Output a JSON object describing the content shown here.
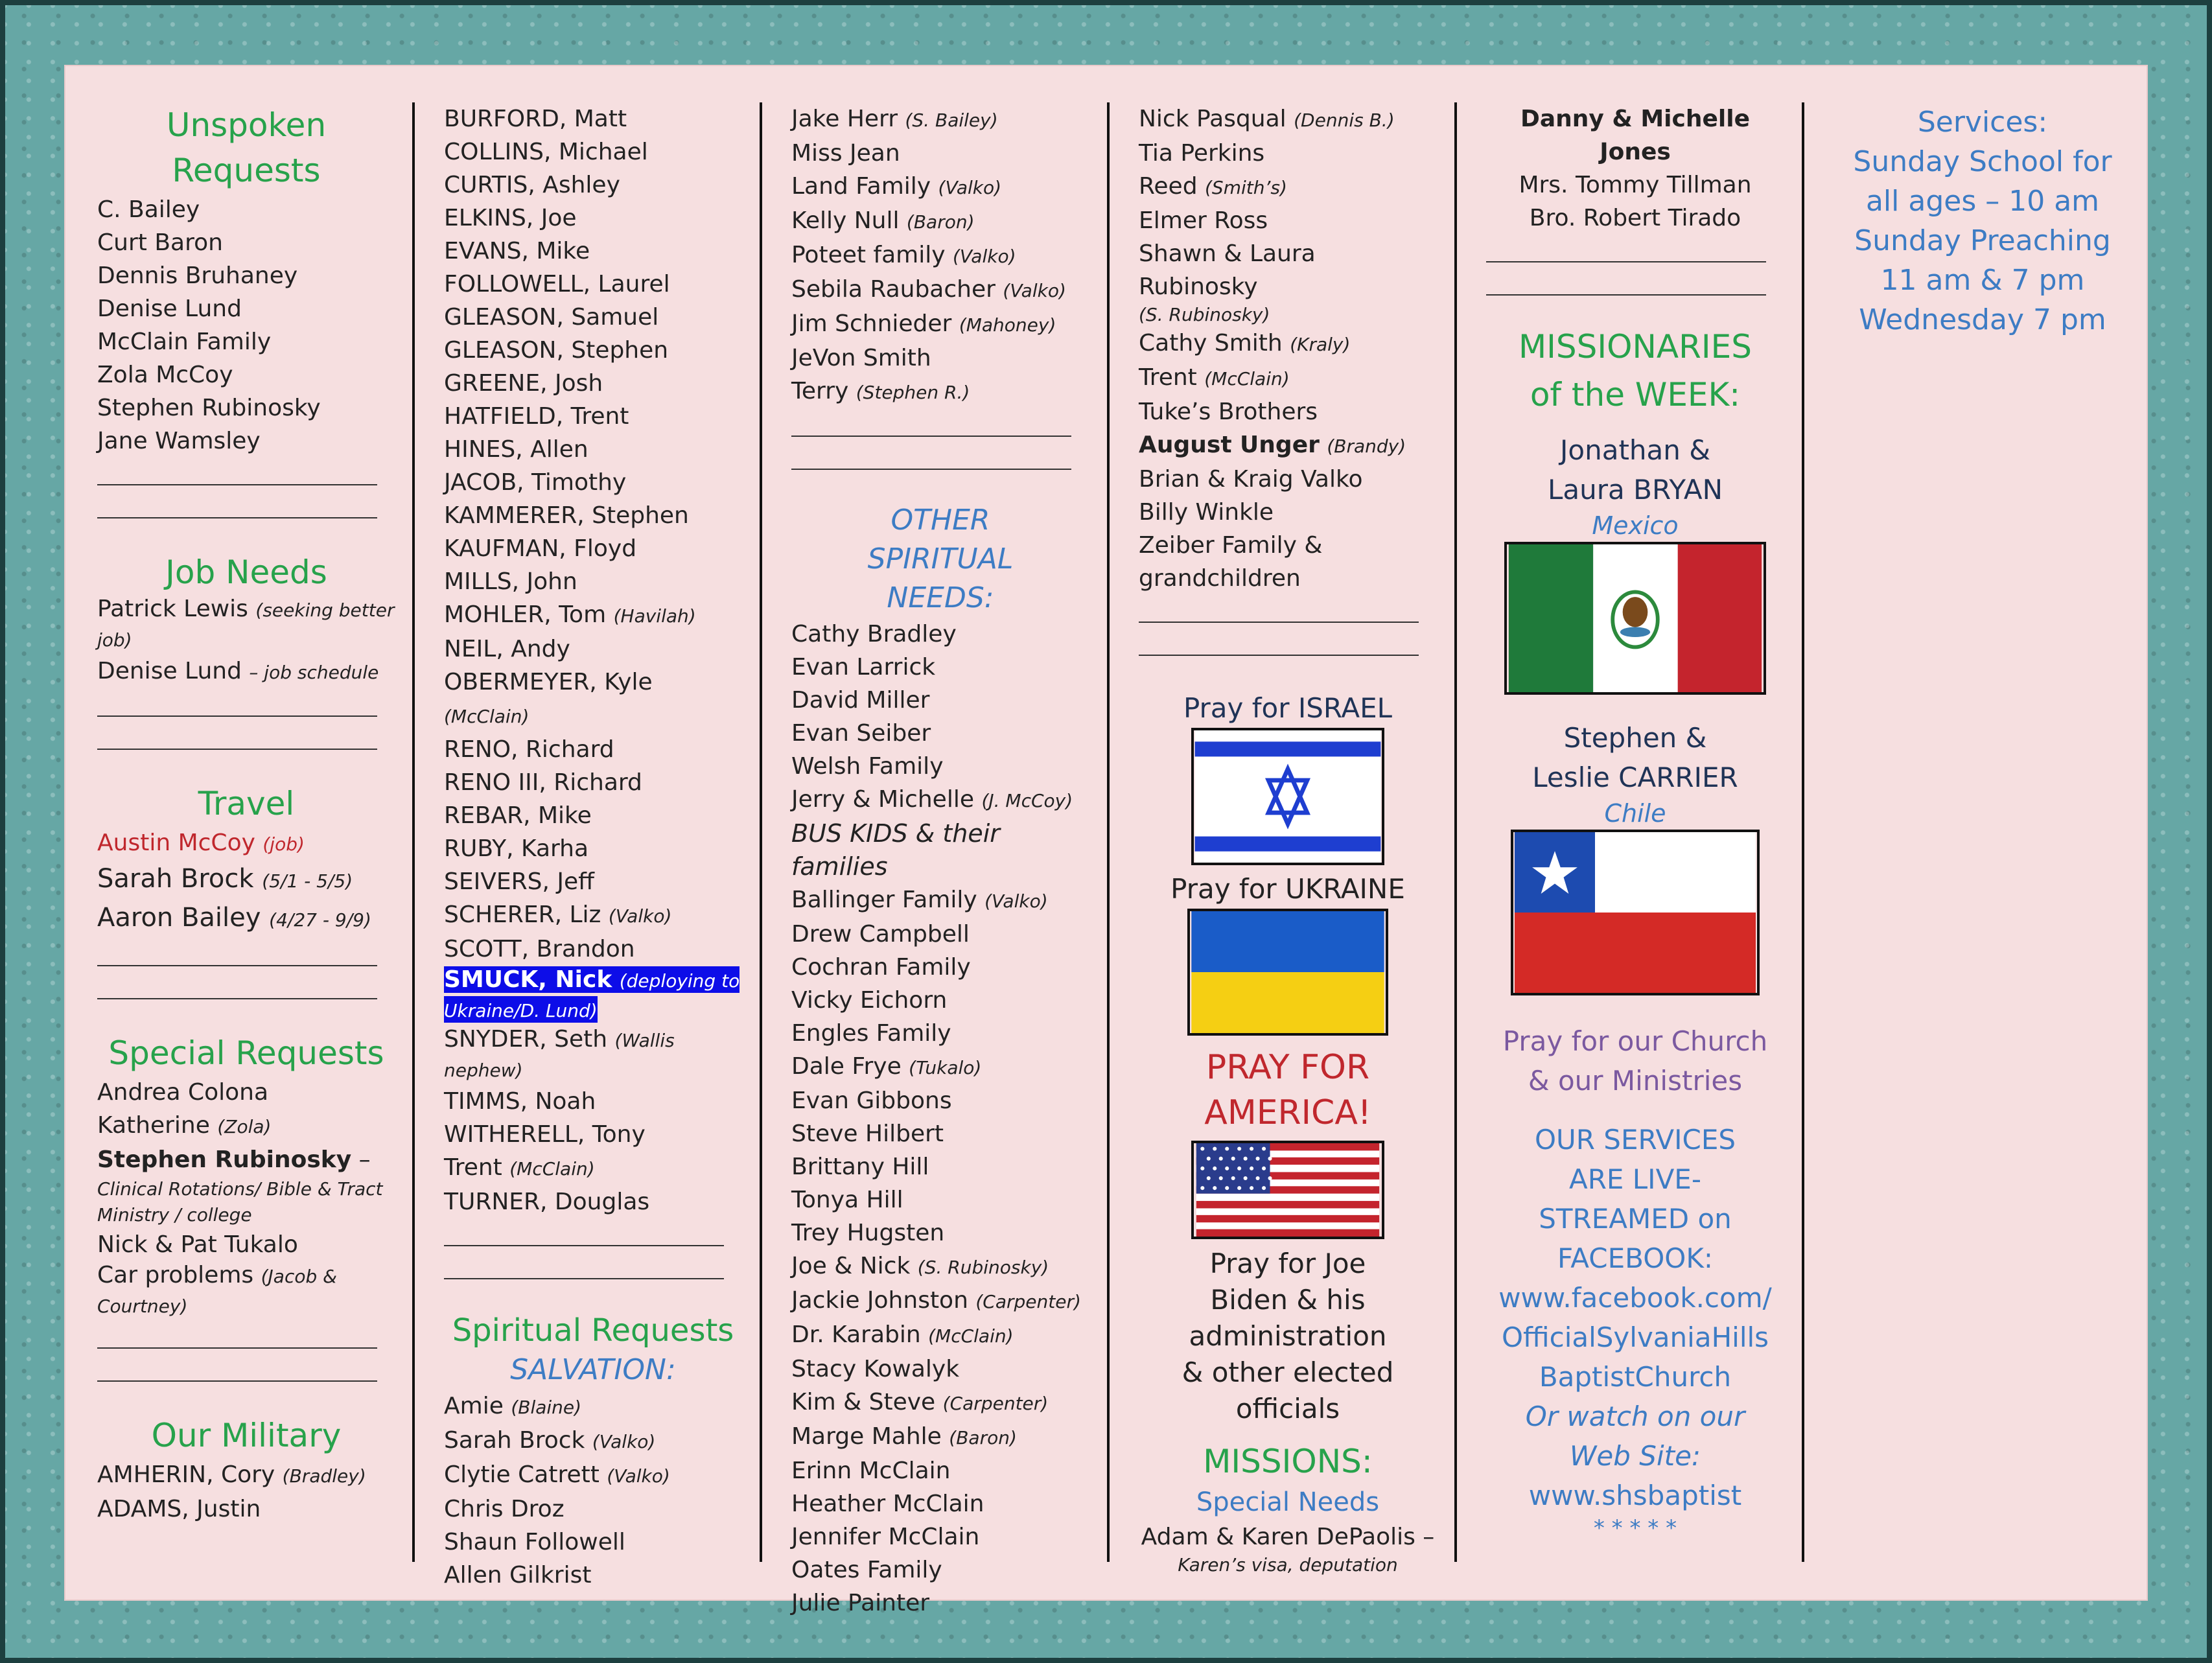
{
  "col1": {
    "unspoken_title": "Unspoken Requests",
    "unspoken": [
      "C. Bailey",
      "Curt Baron",
      "Dennis Bruhaney",
      "Denise Lund",
      "McClain Family",
      "Zola McCoy",
      "Stephen Rubinosky",
      "Jane Wamsley"
    ],
    "job_title": "Job Needs",
    "job1_name": "Patrick Lewis",
    "job1_note": "(seeking better job)",
    "job2_name": "Denise Lund",
    "job2_note": "– job schedule",
    "travel_title": "Travel",
    "travel1_name": "Austin McCoy",
    "travel1_note": "(job)",
    "travel2_name": "Sarah Brock",
    "travel2_note": "(5/1 - 5/5)",
    "travel3_name": "Aaron Bailey",
    "travel3_note": "(4/27 - 9/9)",
    "special_title": "Special Requests",
    "special1": "Andrea Colona",
    "special2_name": "Katherine",
    "special2_note": "(Zola)",
    "special3_name": "Stephen Rubinosky",
    "special3_dash": " –",
    "special3_note": "Clinical Rotations/ Bible & Tract Ministry / college",
    "special4": "Nick & Pat Tukalo",
    "special5_name": "Car problems",
    "special5_note": "(Jacob & Courtney)",
    "military_title": "Our Military",
    "mil1_name": "AMHERIN, Cory",
    "mil1_note": "(Bradley)",
    "mil2": "ADAMS, Justin"
  },
  "col2": {
    "names": [
      {
        "name": "BURFORD, Matt",
        "note": ""
      },
      {
        "name": "COLLINS, Michael",
        "note": ""
      },
      {
        "name": "CURTIS, Ashley",
        "note": ""
      },
      {
        "name": "ELKINS, Joe",
        "note": ""
      },
      {
        "name": "EVANS, Mike",
        "note": ""
      },
      {
        "name": "FOLLOWELL, Laurel",
        "note": ""
      },
      {
        "name": "GLEASON, Samuel",
        "note": ""
      },
      {
        "name": "GLEASON, Stephen",
        "note": ""
      },
      {
        "name": "GREENE, Josh",
        "note": ""
      },
      {
        "name": "HATFIELD, Trent",
        "note": ""
      },
      {
        "name": "HINES, Allen",
        "note": ""
      },
      {
        "name": "JACOB, Timothy",
        "note": ""
      },
      {
        "name": "KAMMERER, Stephen",
        "note": ""
      },
      {
        "name": "KAUFMAN, Floyd",
        "note": ""
      },
      {
        "name": "MILLS, John",
        "note": ""
      },
      {
        "name": "MOHLER, Tom",
        "note": "(Havilah)"
      },
      {
        "name": "NEIL, Andy",
        "note": ""
      },
      {
        "name": "OBERMEYER, Kyle",
        "note": "(McClain)"
      },
      {
        "name": "RENO, Richard",
        "note": ""
      },
      {
        "name": "RENO III, Richard",
        "note": ""
      },
      {
        "name": "REBAR, Mike",
        "note": ""
      },
      {
        "name": "RUBY, Karha",
        "note": ""
      },
      {
        "name": "SEIVERS, Jeff",
        "note": ""
      },
      {
        "name": "SCHERER, Liz",
        "note": "(Valko)"
      },
      {
        "name": "SCOTT, Brandon",
        "note": ""
      }
    ],
    "smuck_name": "SMUCK, Nick",
    "smuck_note": "(deploying to Ukraine/D. Lund)",
    "snyder_name": "SNYDER, Seth",
    "snyder_note": "(Wallis nephew)",
    "names2": [
      {
        "name": "TIMMS, Noah",
        "note": ""
      },
      {
        "name": "WITHERELL, Tony",
        "note": ""
      },
      {
        "name": "Trent",
        "note": "(McClain)"
      },
      {
        "name": "TURNER, Douglas",
        "note": ""
      }
    ],
    "spiritual_title": "Spiritual Requests",
    "salvation_title": "SALVATION:",
    "salvation": [
      {
        "name": "Amie",
        "note": "(Blaine)"
      },
      {
        "name": "Sarah Brock",
        "note": "(Valko)"
      },
      {
        "name": "Clytie Catrett",
        "note": "(Valko)"
      },
      {
        "name": "Chris Droz",
        "note": ""
      },
      {
        "name": "Shaun Followell",
        "note": ""
      },
      {
        "name": "Allen Gilkrist",
        "note": ""
      }
    ]
  },
  "col3": {
    "names": [
      {
        "name": "Jake Herr",
        "note": "(S. Bailey)"
      },
      {
        "name": "Miss Jean",
        "note": ""
      },
      {
        "name": "Land Family",
        "note": "(Valko)"
      },
      {
        "name": "Kelly Null",
        "note": "(Baron)"
      },
      {
        "name": "Poteet family",
        "note": "(Valko)"
      },
      {
        "name": "Sebila Raubacher",
        "note": "(Valko)"
      },
      {
        "name": "Jim Schnieder",
        "note": "(Mahoney)"
      },
      {
        "name": "JeVon Smith",
        "note": ""
      },
      {
        "name": "Terry",
        "note": "(Stephen R.)"
      }
    ],
    "other_title": "OTHER SPIRITUAL NEEDS:",
    "other": [
      {
        "name": "Cathy Bradley",
        "note": ""
      },
      {
        "name": "Evan Larrick",
        "note": ""
      },
      {
        "name": "David Miller",
        "note": ""
      },
      {
        "name": "Evan Seiber",
        "note": ""
      },
      {
        "name": "Welsh Family",
        "note": ""
      },
      {
        "name": "Jerry & Michelle",
        "note": "(J. McCoy)"
      }
    ],
    "bus_kids": "BUS KIDS & their families",
    "other2": [
      {
        "name": "Ballinger Family",
        "note": "(Valko)"
      },
      {
        "name": "Drew Campbell",
        "note": ""
      },
      {
        "name": "Cochran Family",
        "note": ""
      },
      {
        "name": "Vicky Eichorn",
        "note": ""
      },
      {
        "name": "Engles Family",
        "note": ""
      },
      {
        "name": "Dale Frye",
        "note": "(Tukalo)"
      },
      {
        "name": "Evan Gibbons",
        "note": ""
      },
      {
        "name": "Steve Hilbert",
        "note": ""
      },
      {
        "name": "Brittany Hill",
        "note": ""
      },
      {
        "name": "Tonya Hill",
        "note": ""
      },
      {
        "name": "Trey Hugsten",
        "note": ""
      },
      {
        "name": "Joe & Nick",
        "note": "(S. Rubinosky)"
      },
      {
        "name": "Jackie Johnston",
        "note": "(Carpenter)"
      },
      {
        "name": "Dr. Karabin",
        "note": "(McClain)"
      },
      {
        "name": "Stacy Kowalyk",
        "note": ""
      },
      {
        "name": "Kim & Steve",
        "note": "(Carpenter)"
      },
      {
        "name": "Marge Mahle",
        "note": "(Baron)"
      },
      {
        "name": "Erinn McClain",
        "note": ""
      },
      {
        "name": "Heather McClain",
        "note": ""
      },
      {
        "name": "Jennifer McClain",
        "note": ""
      },
      {
        "name": "Oates Family",
        "note": ""
      },
      {
        "name": "Julie Painter",
        "note": ""
      }
    ]
  },
  "col4": {
    "nick_name": "Nick Pasqual",
    "nick_note": "(Dennis B.)",
    "tia": "Tia Perkins",
    "reed_name": "Reed",
    "reed_note": "(Smith’s)",
    "elmer": "Elmer Ross",
    "shawn_name": "Shawn & Laura Rubinosky",
    "shawn_note": "(S. Rubinosky)",
    "cathy_name": "Cathy Smith",
    "cathy_note": "(Kraly)",
    "trent_name": "Trent",
    "trent_note": "(McClain)",
    "tuke": "Tuke’s Brothers",
    "august_name": "August Unger",
    "august_note": "(Brandy)",
    "brian": "Brian & Kraig Valko",
    "billy": "Billy Winkle",
    "zeiber": "Zeiber Family & grandchildren",
    "israel": "Pray for ISRAEL",
    "ukraine": "Pray for UKRAINE",
    "america": "PRAY FOR AMERICA!",
    "biden": "Pray for Joe Biden & his administration & other elected officials",
    "missions": "MISSIONS:",
    "special_needs": "Special Needs",
    "adam": "Adam & Karen DePaolis –",
    "adam_note": "Karen’s visa, deputation"
  },
  "col5": {
    "danny": "Danny & Michelle Jones",
    "tillman": "Mrs. Tommy Tillman",
    "tirado": "Bro. Robert Tirado",
    "missionaries_title": "MISSIONARIES of the WEEK:",
    "bryan": "Jonathan & Laura BRYAN",
    "mexico": "Mexico",
    "carrier": "Stephen & Leslie CARRIER",
    "chile": "Chile",
    "pray_church": "Pray for our Church & our Ministries",
    "livestream": "OUR SERVICES ARE LIVE-STREAMED on FACEBOOK:",
    "facebook": "www.facebook.com/ OfficialSylvaniaHills BaptistChurch",
    "watch": "Or watch on our Web Site:",
    "website": "www.shsbaptist",
    "stars": "* * * * *"
  },
  "col6": {
    "services": "Services:",
    "sunday_school": "Sunday School for all ages – 10 am",
    "preaching": "Sunday Preaching 11 am & 7 pm",
    "wednesday": "Wednesday 7 pm"
  }
}
